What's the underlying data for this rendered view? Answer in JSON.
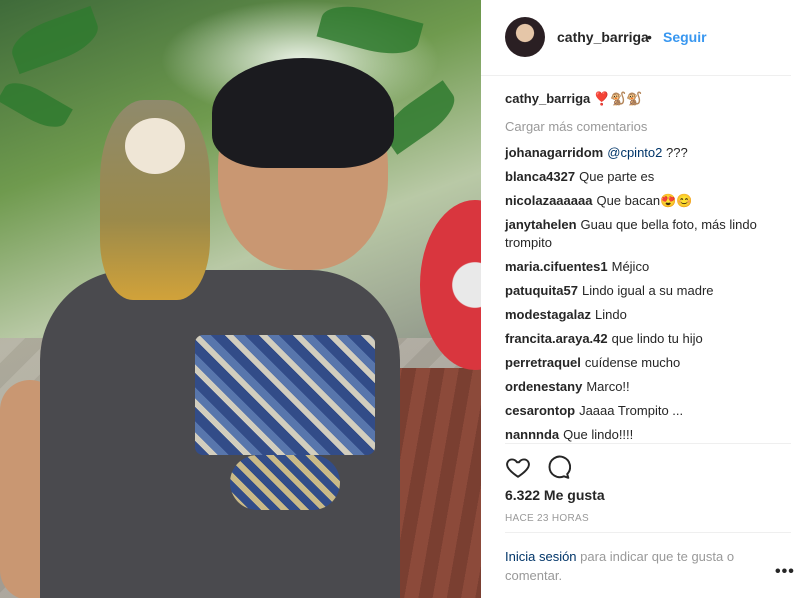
{
  "header": {
    "username": "cathy_barriga",
    "dot": "•",
    "follow_label": "Seguir"
  },
  "caption": {
    "username": "cathy_barriga",
    "text": "❣️🐒🐒"
  },
  "load_more": "Cargar más comentarios",
  "comments": [
    {
      "user": "johanagarridom",
      "text": "",
      "mention": "@cpinto2",
      "suffix": " ???"
    },
    {
      "user": "blanca4327",
      "text": "Que parte es"
    },
    {
      "user": "nicolazaaaaaa",
      "text": "Que bacan😍😊"
    },
    {
      "user": "janytahelen",
      "text": "Guau que bella foto, más lindo trompito"
    },
    {
      "user": "maria.cifuentes1",
      "text": "Méjico"
    },
    {
      "user": "patuquita57",
      "text": "Lindo igual a su madre"
    },
    {
      "user": "modestagalaz",
      "text": "Lindo"
    },
    {
      "user": "francita.araya.42",
      "text": "que lindo tu hijo"
    },
    {
      "user": "perretraquel",
      "text": "cuídense mucho"
    },
    {
      "user": "ordenestany",
      "text": "Marco!!"
    },
    {
      "user": "cesarontop",
      "text": "Jaaaa Trompito ..."
    },
    {
      "user": "nannnda",
      "text": "Que lindo!!!!"
    }
  ],
  "actions": {
    "like_icon": "heart-outline-icon",
    "comment_icon": "comment-bubble-icon"
  },
  "likes": "6.322 Me gusta",
  "time": "HACE 23 HORAS",
  "login": {
    "link": "Inicia sesión",
    "text": " para indicar que te gusta o comentar."
  },
  "more": "•••"
}
